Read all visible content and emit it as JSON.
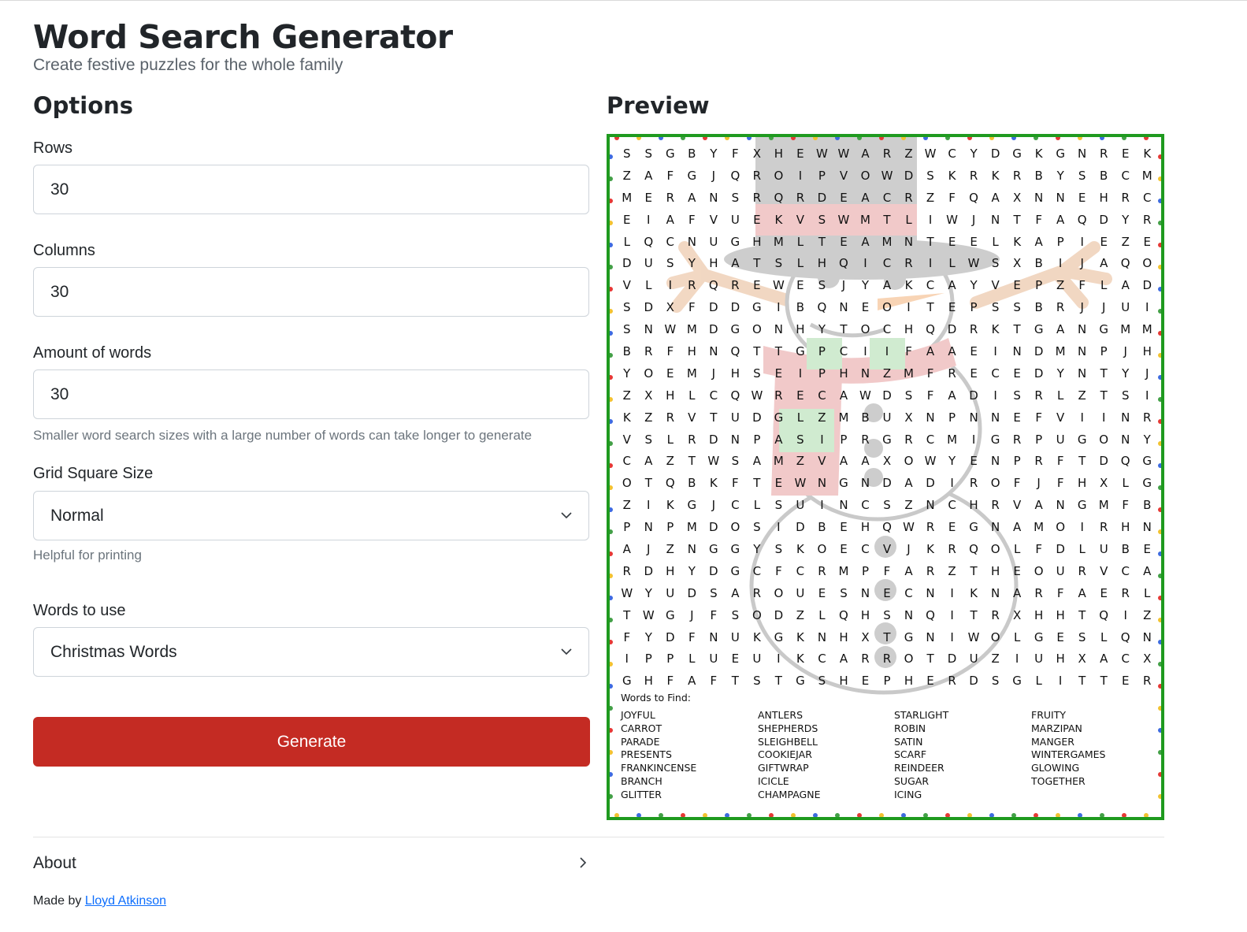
{
  "header": {
    "title": "Word Search Generator",
    "subtitle": "Create festive puzzles for the whole family"
  },
  "options": {
    "heading": "Options",
    "rows": {
      "label": "Rows",
      "value": "30"
    },
    "columns": {
      "label": "Columns",
      "value": "30"
    },
    "amount": {
      "label": "Amount of words",
      "value": "30",
      "hint": "Smaller word search sizes with a large number of words can take longer to generate"
    },
    "grid_size": {
      "label": "Grid Square Size",
      "value": "Normal",
      "hint": "Helpful for printing"
    },
    "words_to_use": {
      "label": "Words to use",
      "value": "Christmas Words"
    },
    "generate_label": "Generate"
  },
  "preview": {
    "heading": "Preview",
    "grid": [
      "SSGBYFXHEWWARZWCYDGKGNREK",
      "ZAFGJQROIPVOWDSKRKRBYSBCM",
      "MERANSRQRDEACRZFQAXNNEHRC",
      "EIAFVUEKVSWMTLIWJNTFAQDYR",
      "LQCNUGHMLTEAMNTEELKAPIEZE",
      "DUSYHATSLHQICRILWSXBIJAQO",
      "VLIRQREWESJYAKCAYVEPZFLAD",
      "SDXFDDGIBQNEOITEPSSBRJJUI",
      "SNWMDGONHYTOCHQDRKTGANGMM",
      "BRFHNQTTGPCIIFAAEINDMNPJH",
      "YOEMJHSEIPHNZMFRECEDYNTYJ",
      "ZXHLCQWRECAWDSFADISRLZTSI",
      "KZRVTUDGLZMBUXNPNNEFVIINR",
      "VSLRDNPASIPRGRCMIGRPUGONY",
      "CAZTWSAMZVAAXOWYENPRFTDQG",
      "OTQBKFTEWNGNDADIROFJFHXLG",
      "ZIKGJCLSUINCSZNCHRVANGMFB",
      "PNPMDOSIDBEHQWREGNAMOIRHN",
      "AJZNGGYSKOECVJKRQOLFDLUBE",
      "RDHYDGCFCRMPFARZTHEOURVCA",
      "WYUDSAROUESNECNIKNARFAERL",
      "TWGJFSODZLQHSNQITRXHHTQIZ",
      "FYDFNUKGKNHXTGNIWOLGESLQN",
      "IPPLUEUIKCARROTDUZIUHXACX",
      "GHFAFTSTGSHEPHERDSGLITTER"
    ],
    "words_title": "Words to Find:",
    "word_columns": [
      [
        "JOYFUL",
        "CARROT",
        "PARADE",
        "PRESENTS",
        "FRANKINCENSE",
        "BRANCH",
        "GLITTER"
      ],
      [
        "ANTLERS",
        "SHEPHERDS",
        "SLEIGHBELL",
        "COOKIEJAR",
        "GIFTWRAP",
        "ICICLE",
        "CHAMPAGNE"
      ],
      [
        "STARLIGHT",
        "ROBIN",
        "SATIN",
        "SCARF",
        "REINDEER",
        "SUGAR",
        "ICING"
      ],
      [
        "FRUITY",
        "MARZIPAN",
        "MANGER",
        "WINTERGAMES",
        "GLOWING",
        "TOGETHER"
      ]
    ],
    "border_color": "#1f9a1f",
    "light_colors": [
      "#e53935",
      "#f2c230",
      "#3d6be0",
      "#43a047"
    ]
  },
  "footer": {
    "about_label": "About",
    "made_by": "Made by",
    "author": "Lloyd Atkinson"
  }
}
